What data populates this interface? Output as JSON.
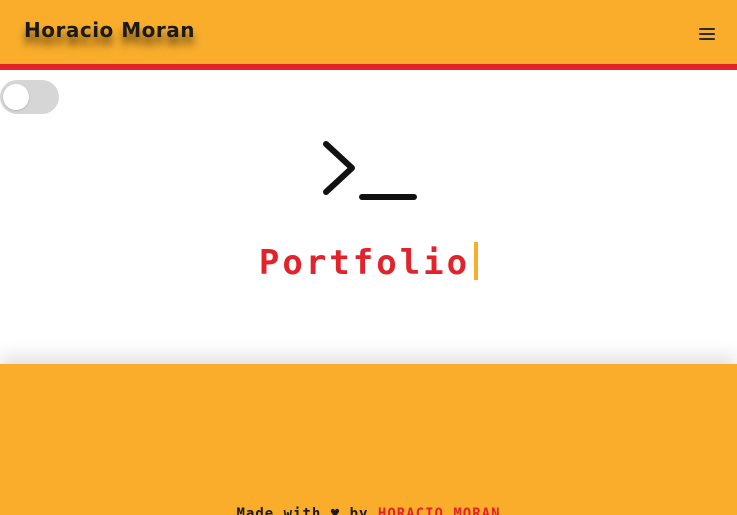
{
  "header": {
    "brand": "Horacio Moran",
    "menu_icon": "menu-icon"
  },
  "toggle": {
    "state": "off"
  },
  "hero": {
    "icon": "terminal-icon",
    "title": "Portfolio"
  },
  "footer": {
    "prefix": "Made with ♥ by ",
    "name": "HORACIO MORAN"
  },
  "colors": {
    "accent_orange": "#f9ad2b",
    "accent_red": "#e3232c",
    "text_dark": "#1a1a1a"
  }
}
